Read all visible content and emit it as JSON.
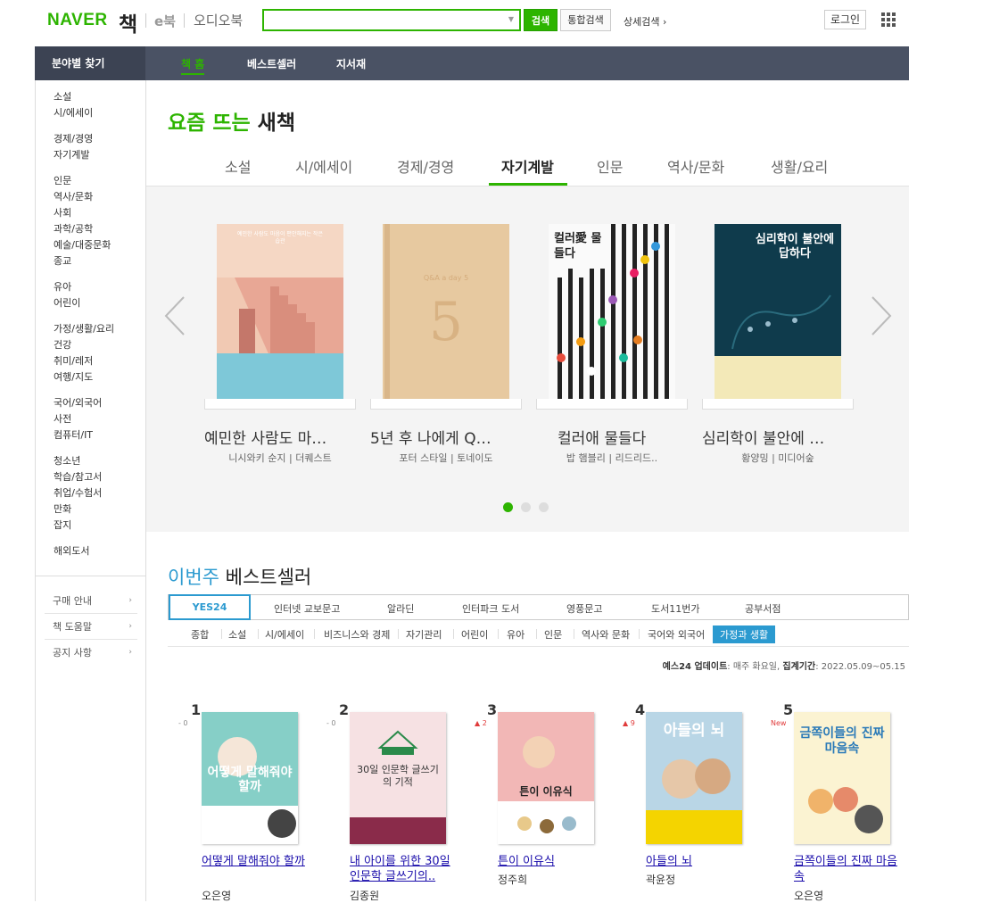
{
  "header": {
    "logo_naver": "NAVER",
    "logo_book": "책",
    "ebook": "e북",
    "audiobook": "오디오북",
    "search_placeholder": "",
    "search_btn": "검색",
    "total_search_btn": "통합검색",
    "detail_search": "상세검색 ›",
    "login_btn": "로그인"
  },
  "navbar": {
    "category_finder": "분야별 찾기",
    "items": [
      "책 홈",
      "베스트셀러",
      "지서재"
    ]
  },
  "sidebar": {
    "groups": [
      [
        "소설",
        "시/에세이"
      ],
      [
        "경제/경영",
        "자기계발"
      ],
      [
        "인문",
        "역사/문화",
        "사회",
        "과학/공학",
        "예술/대중문화",
        "종교"
      ],
      [
        "유아",
        "어린이"
      ],
      [
        "가정/생활/요리",
        "건강",
        "취미/레저",
        "여행/지도"
      ],
      [
        "국어/외국어",
        "사전",
        "컴퓨터/IT"
      ],
      [
        "청소년",
        "학습/참고서",
        "취업/수험서",
        "만화",
        "잡지"
      ],
      [
        "해외도서"
      ]
    ],
    "links": [
      "구매 안내",
      "책 도움말",
      "공지 사항"
    ]
  },
  "new_books": {
    "title_highlight": "요즘 뜨는",
    "title_rest": "새책",
    "tabs": [
      "소설",
      "시/에세이",
      "경제/경영",
      "자기계발",
      "인문",
      "역사/문화",
      "생활/요리"
    ],
    "active_tab": "자기계발",
    "books": [
      {
        "title": "예민한 사람도 마…",
        "meta": "니시와키 순지 | 더퀘스트"
      },
      {
        "title": "5년 후 나에게 Q…",
        "meta": "포터 스타일 | 토네이도"
      },
      {
        "title": "컬러애 물들다",
        "meta": "밥 햄블리 | 리드리드.."
      },
      {
        "title": "심리학이 불안에 …",
        "meta": "황양밍 | 미디어숲"
      }
    ],
    "cover_texts": [
      "예민한 사람도 마음이 편안해지는 작은 습관",
      "Q&A a day 5",
      "컬러愛 물들다",
      "심리학이 불안에 답하다"
    ]
  },
  "bestseller": {
    "title_highlight": "이번주",
    "title_rest": "베스트셀러",
    "stores": [
      "YES24",
      "인터넷 교보문고",
      "알라딘",
      "인터파크 도서",
      "영풍문고",
      "도서11번가",
      "공부서점"
    ],
    "active_store": "YES24",
    "subtabs": [
      "종합",
      "소설",
      "시/에세이",
      "비즈니스와 경제",
      "자기관리",
      "어린이",
      "유아",
      "인문",
      "역사와 문화",
      "국어와 외국어",
      "가정과 생활"
    ],
    "active_subtab": "가정과 생활",
    "update_label": "예스24 업데이트",
    "update_value": ": 매주 화요일,",
    "period_label": "집계기간",
    "period_value": ": 2022.05.09~05.15",
    "items": [
      {
        "rank": "1",
        "change": "- 0",
        "title": "어떻게 말해줘야 할까",
        "author": "오은영"
      },
      {
        "rank": "2",
        "change": "- 0",
        "title": "내 아이를 위한 30일 인문학 글쓰기의..",
        "author": "김종원"
      },
      {
        "rank": "3",
        "change": "▲ 2",
        "title": "튼이 이유식",
        "author": "정주희"
      },
      {
        "rank": "4",
        "change": "▲ 9",
        "title": "아들의 뇌",
        "author": "곽윤정"
      },
      {
        "rank": "5",
        "change": "New",
        "title": "금쪽이들의 진짜 마음속",
        "author": "오은영"
      }
    ],
    "cover_texts": [
      "어떻게 말해줘야 할까",
      "30일 인문학 글쓰기의 기적",
      "튼이 이유식",
      "아들의 뇌",
      "금쪽이들의 진짜 마음속"
    ]
  },
  "colors": {
    "brand": "#2db400",
    "nav_bg": "#4a5264",
    "accent_blue": "#2b9ad0"
  }
}
